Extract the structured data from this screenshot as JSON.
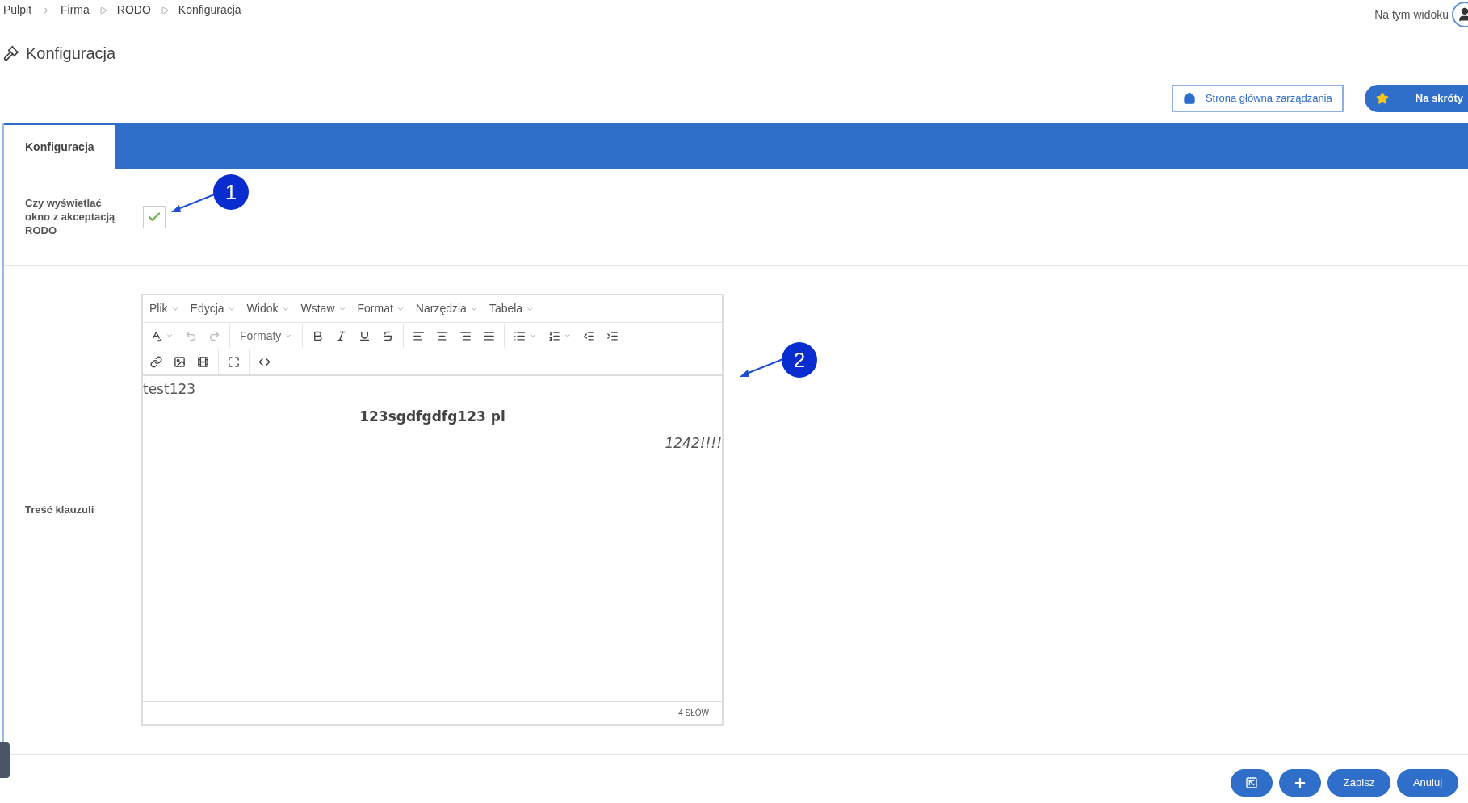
{
  "breadcrumb": [
    {
      "label": "Pulpit",
      "kind": "link"
    },
    {
      "label": "Firma",
      "kind": "text"
    },
    {
      "label": "RODO",
      "kind": "link"
    },
    {
      "label": "Konfiguracja",
      "kind": "link"
    }
  ],
  "view_label": "Na tym widoku",
  "page_title": "Konfiguracja",
  "top_buttons": {
    "home": "Strona główna zarządzania",
    "shortcuts": "Na skróty"
  },
  "tabs": [
    {
      "label": "Konfiguracja",
      "selected": true
    }
  ],
  "form": {
    "checkbox_label": "Czy wyświetlać okno z akceptacją RODO",
    "checked": true,
    "content_label": "Treść klauzuli"
  },
  "editor": {
    "menu": [
      "Plik",
      "Edycja",
      "Widok",
      "Wstaw",
      "Format",
      "Narzędzia",
      "Tabela"
    ],
    "formats_label": "Formaty",
    "paragraphs": [
      {
        "text": "test123",
        "kind": "plain"
      },
      {
        "text": "123sgdfgdfg123 pl",
        "kind": "heading"
      },
      {
        "text": "1242!!!!",
        "kind": "signature"
      }
    ],
    "word_count": "4 SŁÓW"
  },
  "annotations": [
    {
      "label": "1"
    },
    {
      "label": "2"
    }
  ],
  "bottom_buttons": {
    "save": "Zapisz",
    "cancel": "Anuluj"
  }
}
